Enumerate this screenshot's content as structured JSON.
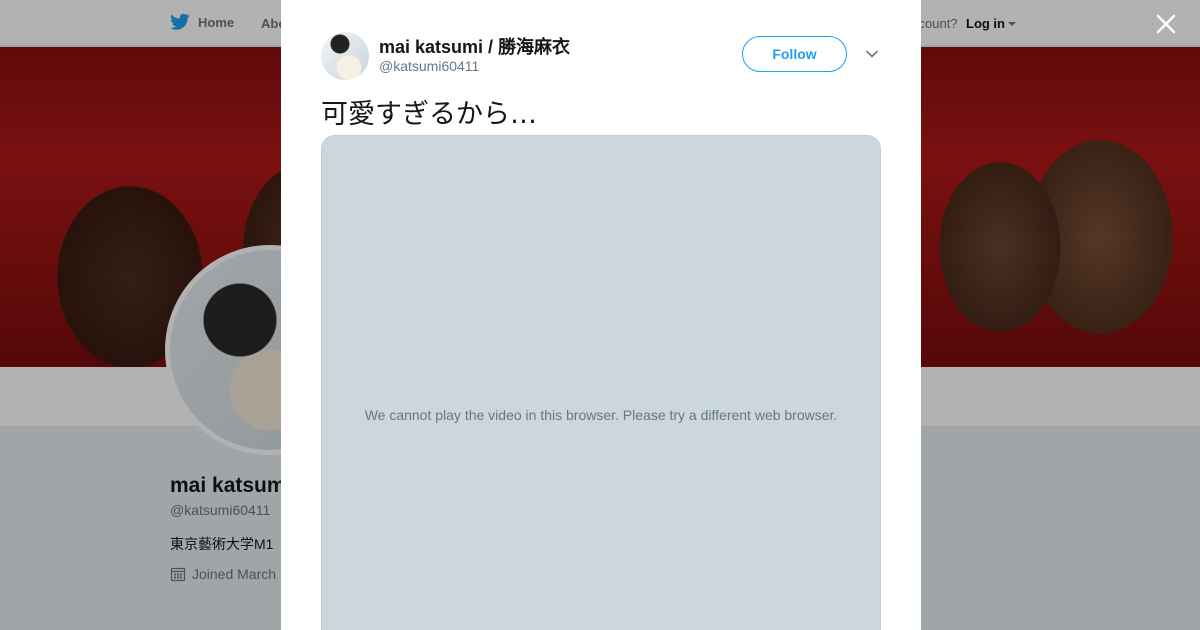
{
  "background_page": {
    "nav": {
      "home_label": "Home",
      "about_label": "Abo",
      "account_prompt": "ccount?",
      "login_label": "Log in"
    },
    "profile": {
      "name": "mai katsumi",
      "handle": "@katsumi60411",
      "bio": "東京藝術大学M1 ",
      "joined": "Joined March"
    }
  },
  "modal": {
    "author": {
      "name": "mai katsumi / 勝海麻衣",
      "handle": "@katsumi60411"
    },
    "follow_label": "Follow",
    "tweet_text": "可愛すぎるから…",
    "video_message": "We cannot play the video in this browser. Please try a different web browser."
  },
  "colors": {
    "accent": "#1da1f2",
    "text_primary": "#14171a",
    "text_secondary": "#657786",
    "video_placeholder": "#ccd6dd"
  },
  "icons": {
    "nav_home": "twitter-bird-icon",
    "close": "close-icon",
    "more": "chevron-down-icon",
    "joined": "calendar-icon"
  }
}
